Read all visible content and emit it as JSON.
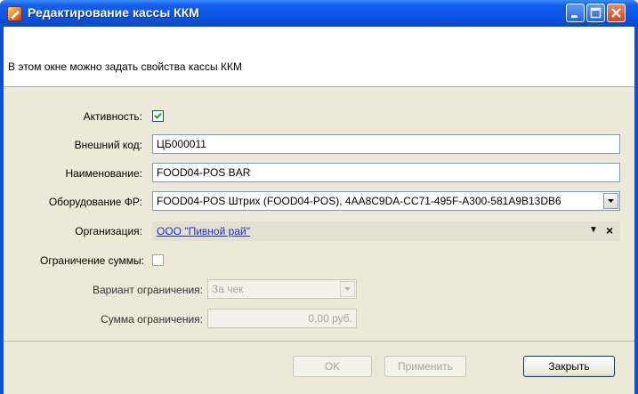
{
  "window": {
    "title": "Редактирование кассы ККМ"
  },
  "header": {
    "description": "В этом окне можно задать свойства кассы ККМ"
  },
  "form": {
    "activity": {
      "label": "Активность:",
      "checked": true
    },
    "external_code": {
      "label": "Внешний код:",
      "value": "ЦБ000011"
    },
    "name": {
      "label": "Наименование:",
      "value": "FOOD04-POS  BAR"
    },
    "equipment": {
      "label": "Оборудование ФР:",
      "value": "FOOD04-POS Штрих (FOOD04-POS), 4AA8C9DA-CC71-495F-A300-581A9B13DB6"
    },
    "organization": {
      "label": "Организация:",
      "value": "ООО \"Пивной рай\""
    },
    "sum_limit": {
      "label": "Ограничение суммы:",
      "checked": false
    },
    "limit_variant": {
      "label": "Вариант ограничения:",
      "value": "За чек"
    },
    "limit_sum": {
      "label": "Сумма ограничения:",
      "value": "0,00 руб."
    }
  },
  "buttons": {
    "ok": "OK",
    "apply": "Применить",
    "close": "Закрыть"
  },
  "colors": {
    "titlebar": "#0a55e6",
    "dialog_bg": "#ece9d8",
    "link": "#1a2fd6"
  }
}
